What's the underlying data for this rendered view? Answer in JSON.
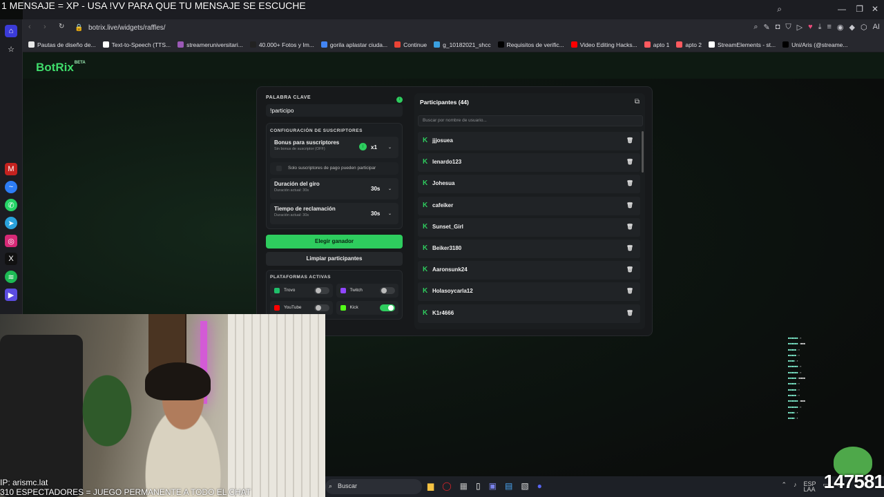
{
  "overlay": {
    "top_text": "1 MENSAJE = XP - USA !VV PARA QUE TU MENSAJE SE ESCUCHE",
    "ip_text": "IP: arismc.lat",
    "bottom_text": "310 ESPECTADORES = JUEGO PERMANENTE A TODO EL CHAT",
    "counter": "147581"
  },
  "browser": {
    "url": "botrix.live/widgets/raffles/",
    "bookmarks": [
      {
        "label": "Pautas de diseño de...",
        "color": "#e8e8e8"
      },
      {
        "label": "Text-to-Speech (TTS...",
        "color": "#ffffff"
      },
      {
        "label": "streameruniversitari...",
        "color": "#9b59b6"
      },
      {
        "label": "40.000+ Fotos y Im...",
        "color": "#222222"
      },
      {
        "label": "gorila aplastar ciuda...",
        "color": "#4285f4"
      },
      {
        "label": "Continue",
        "color": "#ea4335"
      },
      {
        "label": "g_10182021_shcc",
        "color": "#3aa0e0"
      },
      {
        "label": "Requisitos de verific...",
        "color": "#000000"
      },
      {
        "label": "Video Editing Hacks...",
        "color": "#ff0000"
      },
      {
        "label": "apto 1",
        "color": "#ff5a5f"
      },
      {
        "label": "apto 2",
        "color": "#ff5a5f"
      },
      {
        "label": "StreamElements - st...",
        "color": "#ffffff"
      },
      {
        "label": "Uni/Aris (@streame...",
        "color": "#000000"
      }
    ]
  },
  "app": {
    "logo": "BotRix",
    "logo_badge": "BETA",
    "keyword": {
      "label": "PALABRA CLAVE",
      "value": "!participo"
    },
    "subs_config": {
      "label": "CONFIGURACIÓN DE SUSCRIPTORES",
      "bonus_title": "Bonus para suscriptores",
      "bonus_sub": "Sin bonus de suscriptor (OFF)",
      "bonus_value": "x1",
      "only_paid": "Solo suscriptores de pago pueden participar",
      "spin_title": "Duración del giro",
      "spin_sub": "Duración actual: 30s",
      "spin_value": "30s",
      "claim_title": "Tiempo de reclamación",
      "claim_sub": "Duración actual: 30s",
      "claim_value": "30s"
    },
    "pick_winner": "Elegir ganador",
    "clear_participants": "Limpiar participantes",
    "platforms": {
      "label": "PLATAFORMAS ACTIVAS",
      "items": [
        {
          "name": "Trovo",
          "color": "#1fbf6a",
          "on": false
        },
        {
          "name": "Twitch",
          "color": "#9146ff",
          "on": false
        },
        {
          "name": "YouTube",
          "color": "#ff0000",
          "on": false
        },
        {
          "name": "Kick",
          "color": "#53fc18",
          "on": true
        }
      ]
    },
    "participants": {
      "title": "Participantes (44)",
      "search_placeholder": "Buscar por nombre de usuario...",
      "names": [
        "jjjosuea",
        "lenardo123",
        "Johesua",
        "cafeiker",
        "Sunset_Girl",
        "Beiker3180",
        "Aaronsunk24",
        "Holasoycarla12",
        "K1r4666"
      ]
    }
  },
  "taskbar": {
    "search": "Buscar",
    "lang": "ESP",
    "lang2": "LAA"
  },
  "colors": {
    "accent": "#2ecc5e",
    "bg": "#0b0d0c"
  }
}
